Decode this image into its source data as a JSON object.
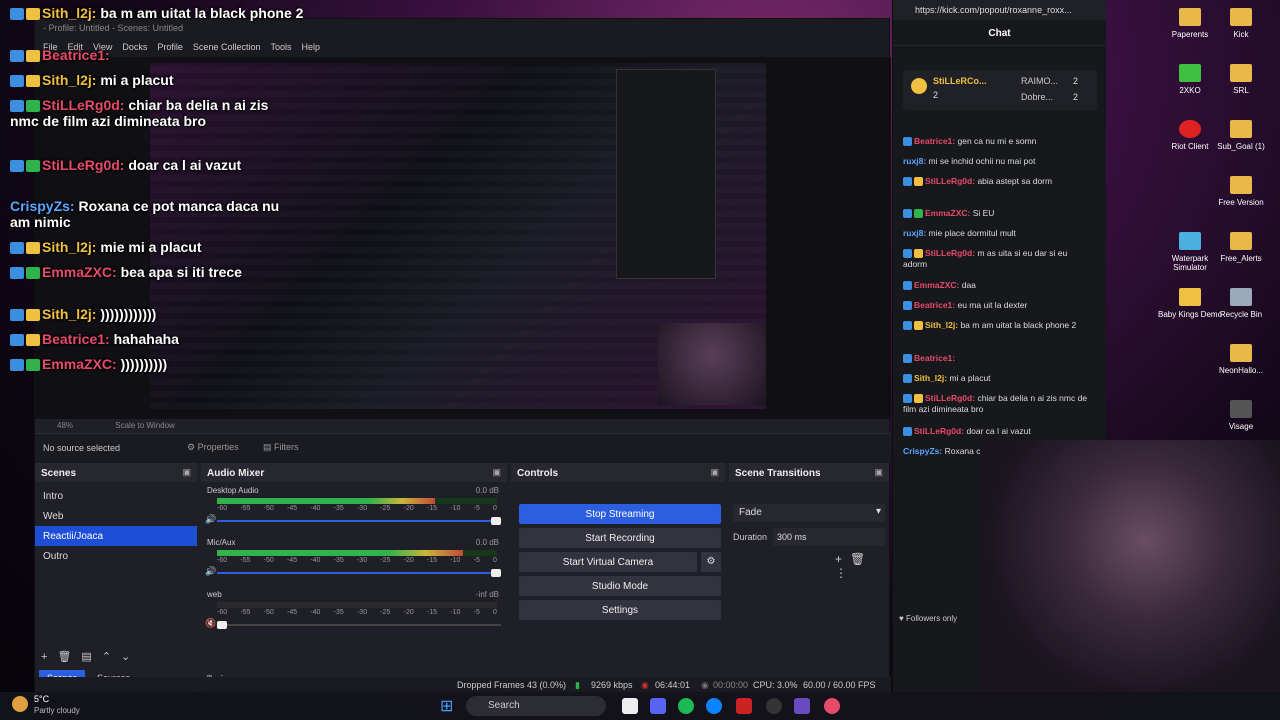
{
  "obs": {
    "title": "- Profile: Untitled - Scenes: Untitled",
    "menu": [
      "File",
      "Edit",
      "View",
      "Docks",
      "Profile",
      "Scene Collection",
      "Tools",
      "Help"
    ],
    "zoom": "48%",
    "scale_mode": "Scale to Window",
    "no_source": "No source selected",
    "properties": "Properties",
    "filters": "Filters",
    "scenes_header": "Scenes",
    "scenes": [
      "Intro",
      "Web",
      "Reactii/Joaca",
      "Outro"
    ],
    "selected_scene": "Reactii/Joaca",
    "tabs": [
      "Scenes",
      "Sources"
    ],
    "mixer_header": "Audio Mixer",
    "mixer": [
      {
        "name": "Desktop Audio",
        "db": "0.0 dB",
        "level": 0.78,
        "volume": 1.0
      },
      {
        "name": "Mic/Aux",
        "db": "0.0 dB",
        "level": 0.88,
        "volume": 1.0
      },
      {
        "name": "web",
        "db": "-inf dB",
        "level": 0.0,
        "volume": 0.0
      }
    ],
    "scale_ticks": [
      "-60",
      "-55",
      "-50",
      "-45",
      "-40",
      "-35",
      "-30",
      "-25",
      "-20",
      "-15",
      "-10",
      "-5",
      "0"
    ],
    "controls_header": "Controls",
    "controls": [
      "Stop Streaming",
      "Start Recording",
      "Start Virtual Camera",
      "Studio Mode",
      "Settings"
    ],
    "transitions_header": "Scene Transitions",
    "transition": "Fade",
    "duration_label": "Duration",
    "duration": "300 ms",
    "status": {
      "dropped": "Dropped Frames 43 (0.0%)",
      "bitrate": "9269 kbps",
      "live_time": "06:44:01",
      "rec_time": "00:00:00",
      "cpu": "CPU: 3.0%",
      "fps": "60.00 / 60.00 FPS"
    }
  },
  "overlay_chat": [
    {
      "user": "Sith_l2j:",
      "msg": "ba m am uitat la black phone 2"
    },
    {
      "user": "Beatrice1:",
      "msg": ""
    },
    {
      "user": "Sith_l2j:",
      "msg": "mi a placut"
    },
    {
      "user": "StiLLeRg0d:",
      "msg": "chiar ba delia n ai zis nmc de film azi dimineata bro"
    },
    {
      "user": "StiLLeRg0d:",
      "msg": "doar ca l ai vazut"
    },
    {
      "user": "CrispyZs:",
      "msg": "Roxana ce pot manca daca nu am nimic"
    },
    {
      "user": "Sith_l2j:",
      "msg": "mie mi a placut"
    },
    {
      "user": "EmmaZXC:",
      "msg": "bea apa si iti trece"
    },
    {
      "user": "Sith_l2j:",
      "msg": "))))))))))))"
    },
    {
      "user": "Beatrice1:",
      "msg": "hahahaha"
    },
    {
      "user": "EmmaZXC:",
      "msg": "))))))))))"
    }
  ],
  "kick": {
    "url": "https://kick.com/popout/roxanne_roxx...",
    "title": "Chat",
    "top1": "StiLLeRCo...",
    "top1_count": "2",
    "top2": "RAIMO...",
    "top2_count": "2",
    "top3": "Dobre...",
    "top3_count": "2",
    "messages": [
      {
        "user": "Beatrice1:",
        "msg": "gen ca nu mi e somn",
        "color": "#e84a6a"
      },
      {
        "user": "ruxj8:",
        "msg": "mi se inchid ochii nu mai pot",
        "color": "#5aa7ff"
      },
      {
        "user": "StiLLeRg0d:",
        "msg": "abia astept sa dorm",
        "color": "#e84a6a"
      },
      {
        "user": "EmmaZXC:",
        "msg": "Si EU",
        "color": "#e84a6a"
      },
      {
        "user": "ruxj8:",
        "msg": "mie place dormitul mult",
        "color": "#5aa7ff"
      },
      {
        "user": "StiLLeRg0d:",
        "msg": "m as uita si eu dar si eu adorm",
        "color": "#e84a6a"
      },
      {
        "user": "EmmaZXC:",
        "msg": "daa",
        "color": "#e84a6a"
      },
      {
        "user": "Beatrice1:",
        "msg": "eu ma uit la dexter",
        "color": "#e84a6a"
      },
      {
        "user": "Sith_l2j:",
        "msg": "ba m am uitat la black phone 2",
        "color": "#f0c040"
      },
      {
        "user": "Beatrice1:",
        "msg": "",
        "color": "#e84a6a"
      },
      {
        "user": "Sith_l2j:",
        "msg": "mi a placut",
        "color": "#f0c040"
      },
      {
        "user": "StiLLeRg0d:",
        "msg": "chiar ba delia n ai zis nmc de film azi dimineata bro",
        "color": "#e84a6a"
      },
      {
        "user": "StiLLeRg0d:",
        "msg": "doar ca l ai vazut",
        "color": "#e84a6a"
      },
      {
        "user": "CrispyZs:",
        "msg": "Roxana c nimic",
        "color": "#5aa7ff"
      }
    ],
    "followers": "Followers only"
  },
  "desktop_icons": [
    "Paperents",
    "Kick",
    "2XKO",
    "SRL",
    "Riot Client",
    "Sub_Goal (1)",
    "Free Version",
    "Waterpark Simulator",
    "Free_Alerts",
    "Baby Kings Demo",
    "Recycle Bin",
    "NeonHallo...",
    "Visage"
  ],
  "taskbar": {
    "search": "Search",
    "weather_temp": "5°C",
    "weather_desc": "Partly cloudy"
  }
}
